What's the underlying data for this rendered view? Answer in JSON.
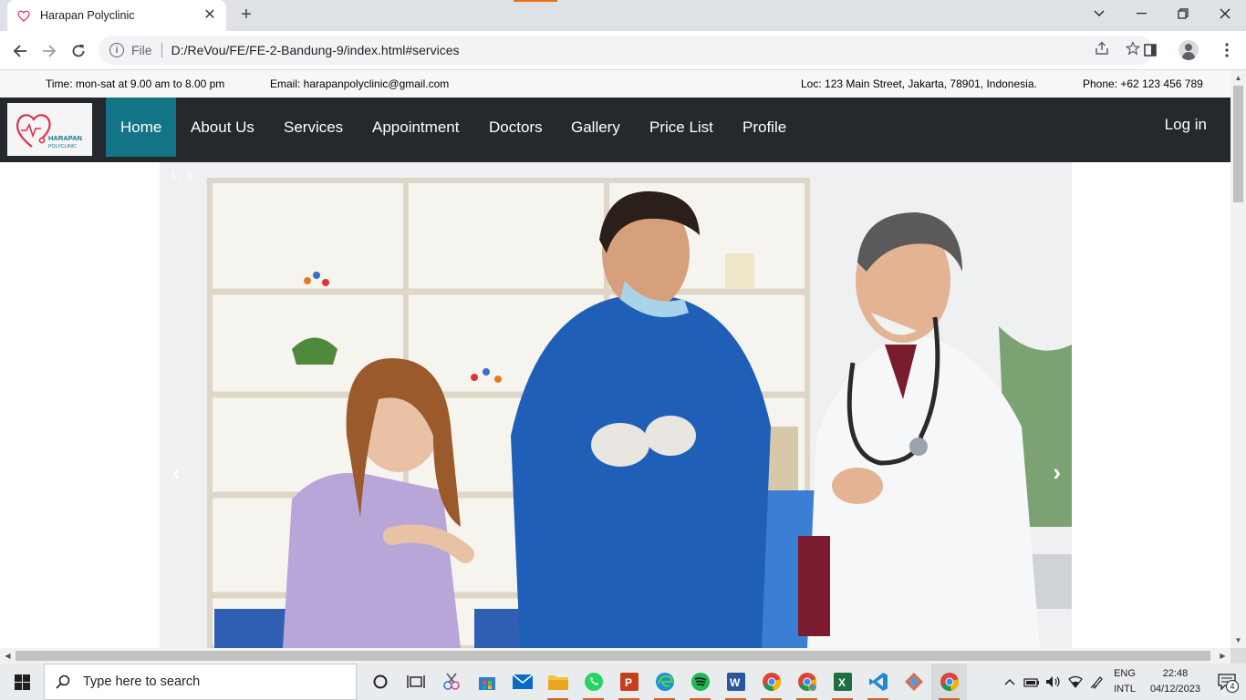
{
  "browser": {
    "tab_title": "Harapan Polyclinic",
    "omnibox_scheme_label": "File",
    "url": "D:/ReVou/FE/FE-2-Bandung-9/index.html#services"
  },
  "page": {
    "infobar": {
      "time": "Time: mon-sat at 9.00 am to 8.00 pm",
      "email": "Email: harapanpolyclinic@gmail.com",
      "location": "Loc: 123 Main Street, Jakarta, 78901, Indonesia.",
      "phone": "Phone: +62 123 456 789"
    },
    "logo": {
      "line1": "HARAPAN",
      "line2": "POLYCLINIC"
    },
    "nav": {
      "items": [
        "Home",
        "About Us",
        "Services",
        "Appointment",
        "Doctors",
        "Gallery",
        "Price List",
        "Profile"
      ],
      "active_index": 0,
      "login": "Log in"
    },
    "carousel": {
      "counter": "1 / 3",
      "prev_glyph": "‹",
      "next_glyph": "›"
    },
    "colors": {
      "nav_bg": "#25282c",
      "active_nav": "#137387",
      "logo_accent": "#d9354a"
    }
  },
  "taskbar": {
    "search_placeholder": "Type here to search",
    "apps": [
      "cortana",
      "task-view",
      "snipping",
      "store",
      "mail",
      "file-explorer",
      "whatsapp",
      "powerpoint",
      "edge",
      "spotify",
      "word",
      "chrome",
      "chrome-2",
      "excel",
      "vscode",
      "git",
      "chrome-3"
    ],
    "lang_line1": "ENG",
    "lang_line2": "INTL",
    "time": "22:48",
    "date": "04/12/2023",
    "notification_count": "4"
  }
}
